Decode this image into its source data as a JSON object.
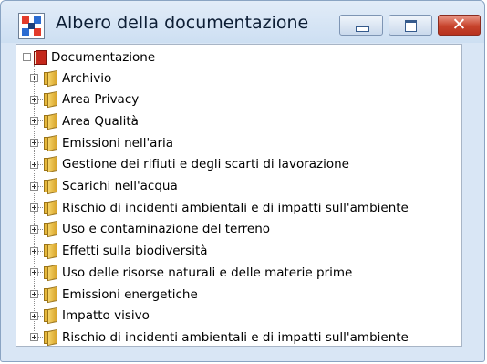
{
  "window": {
    "title": "Albero della documentazione",
    "close_glyph": "✕"
  },
  "tree": {
    "root": {
      "label": "Documentazione",
      "expanded": true,
      "icon": "book-icon"
    },
    "items": [
      {
        "label": "Archivio",
        "expanded": false,
        "icon": "folder-icon"
      },
      {
        "label": "Area Privacy",
        "expanded": false,
        "icon": "folder-icon"
      },
      {
        "label": "Area Qualità",
        "expanded": false,
        "icon": "folder-icon"
      },
      {
        "label": "Emissioni nell'aria",
        "expanded": false,
        "icon": "folder-icon"
      },
      {
        "label": "Gestione dei rifiuti e degli scarti di lavorazione",
        "expanded": false,
        "icon": "folder-icon"
      },
      {
        "label": "Scarichi nell'acqua",
        "expanded": false,
        "icon": "folder-icon"
      },
      {
        "label": "Rischio di incidenti ambientali e di impatti sull'ambiente",
        "expanded": false,
        "icon": "folder-icon"
      },
      {
        "label": "Uso e contaminazione del terreno",
        "expanded": false,
        "icon": "folder-icon"
      },
      {
        "label": "Effetti sulla biodiversità",
        "expanded": false,
        "icon": "folder-icon"
      },
      {
        "label": "Uso delle risorse naturali e delle materie prime",
        "expanded": false,
        "icon": "folder-icon"
      },
      {
        "label": "Emissioni energetiche",
        "expanded": false,
        "icon": "folder-icon"
      },
      {
        "label": "Impatto visivo",
        "expanded": false,
        "icon": "folder-icon"
      },
      {
        "label": "Rischio di incidenti ambientali e di impatti sull'ambiente",
        "expanded": false,
        "icon": "folder-icon"
      }
    ]
  },
  "colors": {
    "titlebar": "#d9e6f5",
    "close_button": "#c7432c",
    "folder": "#e6b83c",
    "root_book": "#c4271b"
  }
}
